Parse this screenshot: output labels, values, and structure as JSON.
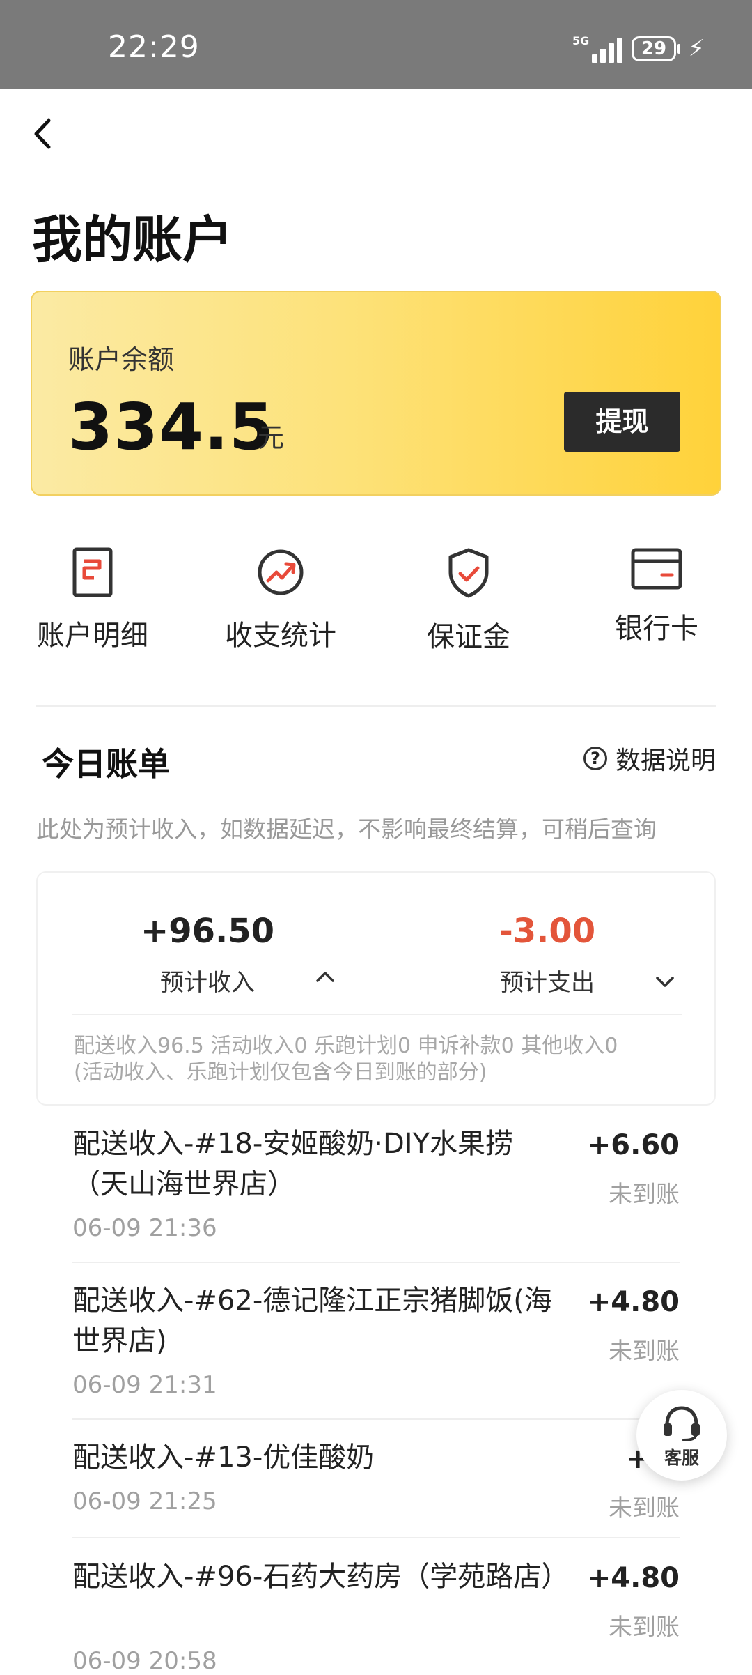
{
  "status_bar": {
    "time": "22:29",
    "network": "5G",
    "battery": "29"
  },
  "header": {
    "title": "我的账户"
  },
  "balance_card": {
    "label": "账户余额",
    "amount": "334.5",
    "unit": "元",
    "withdraw_label": "提现",
    "colors": {
      "gradient_start": "#fbeaa4",
      "gradient_end": "#ffd23a"
    }
  },
  "shortcuts": [
    {
      "label": "账户明细",
      "icon": "document-icon"
    },
    {
      "label": "收支统计",
      "icon": "trend-chart-icon"
    },
    {
      "label": "保证金",
      "icon": "shield-check-icon"
    },
    {
      "label": "银行卡",
      "icon": "bank-card-icon"
    }
  ],
  "today_bill": {
    "title": "今日账单",
    "explain_label": "数据说明",
    "note": "此处为预计收入，如数据延迟，不影响最终结算，可稍后查询",
    "income": {
      "value": "+96.50",
      "label": "预计收入"
    },
    "expense": {
      "value": "-3.00",
      "label": "预计支出",
      "color": "#e3553a"
    },
    "detail_line1": "配送收入96.5 活动收入0 乐跑计划0 申诉补款0 其他收入0",
    "detail_line2": "(活动收入、乐跑计划仅包含今日到账的部分)"
  },
  "transactions": [
    {
      "title": "配送收入-#18-安姬酸奶·DIY水果捞（天山海世界店）",
      "time": "06-09 21:36",
      "amount": "+6.60",
      "status": "未到账"
    },
    {
      "title": "配送收入-#62-德记隆江正宗猪脚饭(海世界店)",
      "time": "06-09 21:31",
      "amount": "+4.80",
      "status": "未到账"
    },
    {
      "title": "配送收入-#13-优佳酸奶",
      "time": "06-09 21:25",
      "amount": "+5.",
      "status": "未到账"
    },
    {
      "title": "配送收入-#96-石药大药房（学苑路店）",
      "time": "06-09 20:58",
      "amount": "+4.80",
      "status": "未到账"
    }
  ],
  "service_button": {
    "label": "客服"
  }
}
